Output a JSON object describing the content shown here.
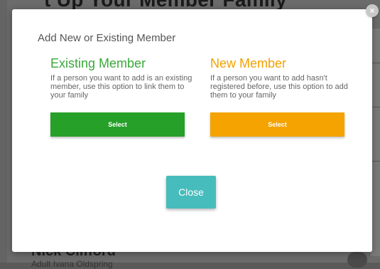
{
  "background": {
    "header_text": "t Up Your Member Family",
    "person_name": "Nick Clifford",
    "person_subtitle": "Adult Ivana Oldspring"
  },
  "modal": {
    "close_icon": "×",
    "title": "Add New or Existing Member",
    "existing": {
      "heading_prefix": "Existing",
      "heading_suffix": "Member",
      "description": "If a person you want to add is an existing member, use this option to link them to your family",
      "select_label": "Select",
      "color": "#27a02a"
    },
    "new": {
      "heading": "New Member",
      "description": "If a person you want to add hasn't registered before, use this option to add them to your family",
      "select_label": "Select",
      "color": "#f4a300"
    },
    "close_label": "Close",
    "close_color": "#47bcbc"
  }
}
